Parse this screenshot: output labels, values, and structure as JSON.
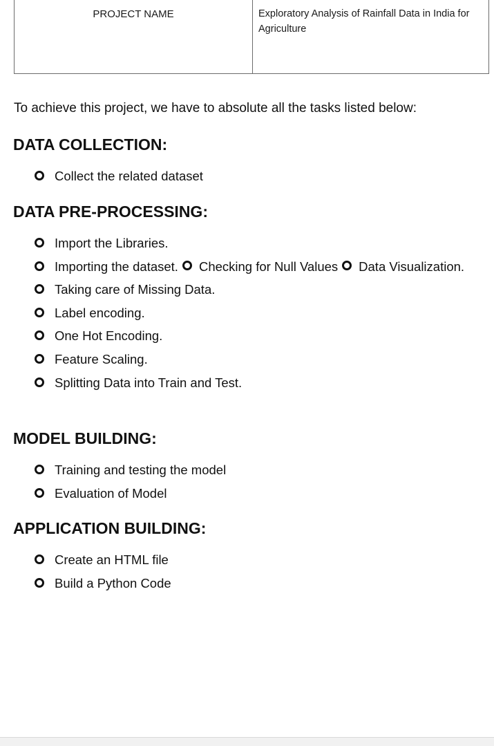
{
  "project_table": {
    "label": "PROJECT NAME",
    "value": "Exploratory Analysis of Rainfall Data in India for Agriculture"
  },
  "intro": "To achieve this project, we have to absolute all the tasks listed below:",
  "sections": {
    "data_collection": {
      "heading": "DATA COLLECTION:",
      "items": [
        "Collect the related dataset"
      ]
    },
    "data_preprocessing": {
      "heading": "DATA PRE-PROCESSING:",
      "items": [
        "Import the Libraries.",
        "Importing the dataset.",
        "Checking for Null Values",
        "Data Visualization.",
        "Taking care of Missing Data.",
        "Label encoding.",
        "One Hot Encoding.",
        "Feature Scaling.",
        "Splitting Data into Train and Test."
      ]
    },
    "model_building": {
      "heading": "MODEL BUILDING:",
      "items": [
        "Training and testing the model",
        "Evaluation of Model"
      ]
    },
    "application_building": {
      "heading": "APPLICATION BUILDING:",
      "items": [
        "Create an HTML file",
        "Build a Python Code"
      ]
    }
  },
  "icons": {
    "bullet": "hollow-circle-icon"
  }
}
